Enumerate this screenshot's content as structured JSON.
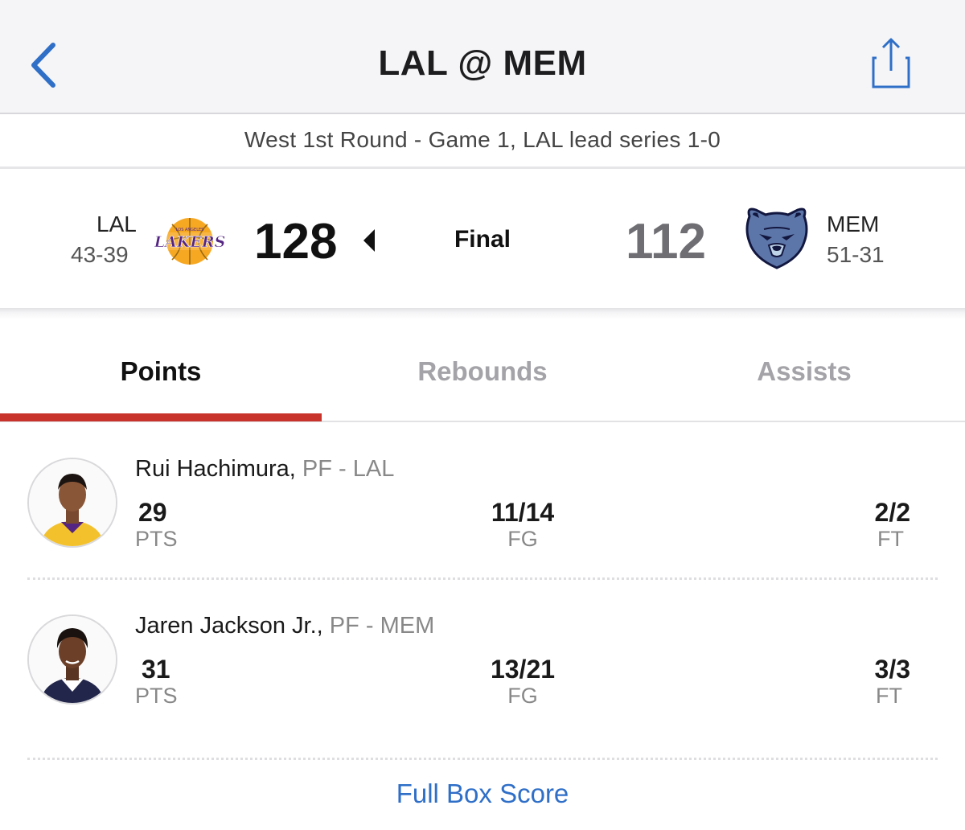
{
  "nav": {
    "title": "LAL @ MEM",
    "back_icon": "chevron-left-icon",
    "share_icon": "share-icon",
    "accent": "#2f6fc8"
  },
  "series": {
    "text": "West 1st Round - Game 1, LAL lead series 1-0"
  },
  "game": {
    "status": "Final",
    "away": {
      "abbr": "LAL",
      "record": "43-39",
      "score": "128",
      "logo": "lakers-logo",
      "color": "#552583"
    },
    "home": {
      "abbr": "MEM",
      "record": "51-31",
      "score": "112",
      "logo": "grizzlies-logo",
      "color": "#5d76a9"
    }
  },
  "tabs": [
    {
      "label": "Points",
      "active": true
    },
    {
      "label": "Rebounds",
      "active": false
    },
    {
      "label": "Assists",
      "active": false
    }
  ],
  "tab_indicator_color": "#c8342c",
  "leaders": [
    {
      "name": "Rui Hachimura,",
      "meta": "PF - LAL",
      "stats": [
        {
          "value": "29",
          "label": "PTS"
        },
        {
          "value": "11/14",
          "label": "FG"
        },
        {
          "value": "2/2",
          "label": "FT"
        }
      ]
    },
    {
      "name": "Jaren Jackson Jr.,",
      "meta": "PF - MEM",
      "stats": [
        {
          "value": "31",
          "label": "PTS"
        },
        {
          "value": "13/21",
          "label": "FG"
        },
        {
          "value": "3/3",
          "label": "FT"
        }
      ]
    }
  ],
  "footer": {
    "link": "Full Box Score"
  }
}
